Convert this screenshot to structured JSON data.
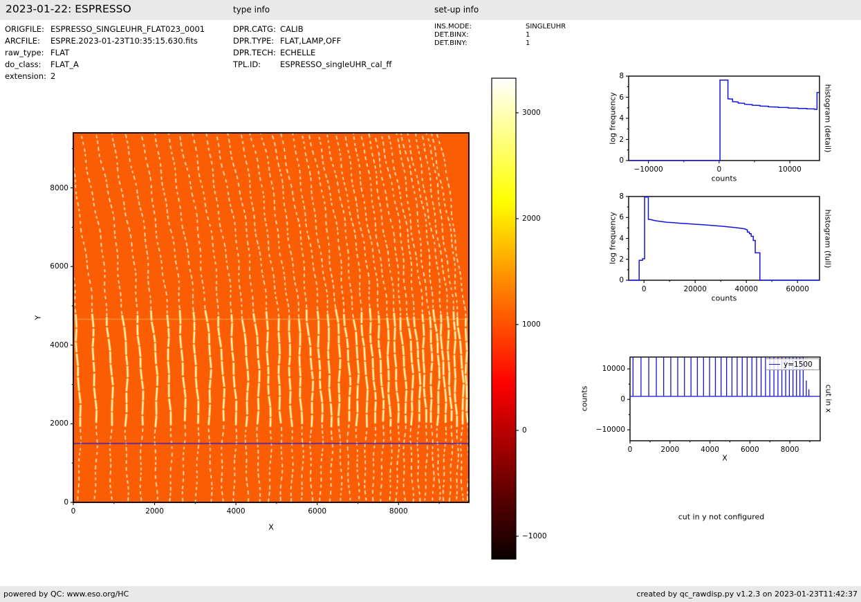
{
  "header": {
    "title": "2023-01-22: ESPRESSO",
    "type_info_title": "type info",
    "setup_info_title": "set-up info"
  },
  "metadata": {
    "file": [
      {
        "label": "ORIGFILE:",
        "value": "ESPRESSO_SINGLEUHR_FLAT023_0001"
      },
      {
        "label": "ARCFILE:",
        "value": "ESPRE.2023-01-23T10:35:15.630.fits"
      },
      {
        "label": "raw_type:",
        "value": "FLAT"
      },
      {
        "label": "do_class:",
        "value": "FLAT_A"
      },
      {
        "label": "extension:",
        "value": "2"
      }
    ],
    "type": [
      {
        "label": "DPR.CATG:",
        "value": "CALIB"
      },
      {
        "label": "DPR.TYPE:",
        "value": "FLAT,LAMP,OFF"
      },
      {
        "label": "DPR.TECH:",
        "value": "ECHELLE"
      },
      {
        "label": "TPL.ID:",
        "value": "ESPRESSO_singleUHR_cal_ff"
      }
    ],
    "setup": [
      {
        "label": "INS.MODE:",
        "value": "SINGLEUHR"
      },
      {
        "label": "DET.BINX:",
        "value": "1"
      },
      {
        "label": "DET.BINY:",
        "value": "1"
      }
    ]
  },
  "notes": {
    "cut_in_y": "cut in y not configured"
  },
  "footer": {
    "left": "powered by QC: www.eso.org/HC",
    "right": "created by qc_rawdisp.py v1.2.3 on 2023-01-23T11:42:37"
  },
  "colors": {
    "curve": "#1212e0",
    "image_background": "#fa5d04",
    "stripe_core": "#ffffff",
    "stripe_glow": "#ffc83c",
    "bar_bg": "#e9e9e9",
    "frame": "#000000"
  },
  "chart_data": [
    {
      "id": "raw-image",
      "type": "heatmap",
      "xlabel": "X",
      "ylabel": "Y",
      "xlim": [
        0,
        9730
      ],
      "ylim": [
        0,
        9400
      ],
      "xticks": [
        0,
        2000,
        4000,
        6000,
        8000
      ],
      "xminor": [
        1000,
        3000,
        5000,
        7000,
        9000
      ],
      "yticks": [
        0,
        2000,
        4000,
        6000,
        8000
      ],
      "yminor": [
        1000,
        3000,
        5000,
        7000,
        9000
      ],
      "description": "ESPRESSO echelle flat-field raw frame: ~40 curved dashed echelle order stripes on orange background (~1080 counts); orders brighter and nearly solid between y=1900 and y=4660; detector seam at y=4660; blue horizontal cut line at y=1500.",
      "background_counts": 1080,
      "cut_line_y": 1500,
      "bright_band_y": [
        1900,
        4660
      ],
      "seam_y": 4660,
      "order_positions": [
        150,
        550,
        939,
        1317,
        1684,
        2041,
        2388,
        2725,
        3052,
        3371,
        3680,
        3981,
        4274,
        4558,
        4834,
        5102,
        5363,
        5617,
        5863,
        6103,
        6336,
        6562,
        6782,
        6996,
        7203,
        7405,
        7601,
        7792,
        7977,
        8158,
        8333,
        8503,
        8668,
        8829,
        8985,
        9137,
        9285,
        9428,
        9568,
        9703
      ],
      "colorbar": {
        "colormap": "hot",
        "range": [
          -1216,
          3327
        ],
        "ticks": [
          -1000,
          0,
          1000,
          2000,
          3000
        ]
      }
    },
    {
      "id": "histogram-detail",
      "type": "line",
      "side_label": "histogram (detail)",
      "xlabel": "counts",
      "ylabel": "log frequency",
      "xlim": [
        -12800,
        14200
      ],
      "ylim": [
        0,
        8
      ],
      "xticks": [
        -10000,
        0,
        10000
      ],
      "xminor": [
        -5000,
        5000
      ],
      "yticks": [
        0,
        2,
        4,
        6,
        8
      ],
      "yminor": [
        1,
        3,
        5,
        7
      ],
      "points": [
        [
          -12800,
          0
        ],
        [
          120,
          0
        ],
        [
          120,
          7.62
        ],
        [
          1250,
          7.62
        ],
        [
          1250,
          5.85
        ],
        [
          1900,
          5.82
        ],
        [
          1900,
          5.58
        ],
        [
          2700,
          5.55
        ],
        [
          2700,
          5.45
        ],
        [
          3600,
          5.42
        ],
        [
          3600,
          5.33
        ],
        [
          4700,
          5.3
        ],
        [
          4700,
          5.24
        ],
        [
          5800,
          5.22
        ],
        [
          5800,
          5.16
        ],
        [
          7000,
          5.14
        ],
        [
          7000,
          5.09
        ],
        [
          8400,
          5.07
        ],
        [
          8400,
          5.03
        ],
        [
          9800,
          5.02
        ],
        [
          9800,
          4.98
        ],
        [
          11200,
          4.97
        ],
        [
          11200,
          4.94
        ],
        [
          12400,
          4.93
        ],
        [
          12400,
          4.9
        ],
        [
          13500,
          4.89
        ],
        [
          13500,
          4.85
        ],
        [
          13850,
          4.85
        ],
        [
          13850,
          6.45
        ],
        [
          14200,
          6.45
        ]
      ]
    },
    {
      "id": "histogram-full",
      "type": "line",
      "side_label": "histogram (full)",
      "xlabel": "counts",
      "ylabel": "log frequency",
      "xlim": [
        -6000,
        68600
      ],
      "ylim": [
        0,
        8
      ],
      "xticks": [
        0,
        20000,
        40000,
        60000
      ],
      "xminor": [
        10000,
        30000,
        50000
      ],
      "yticks": [
        0,
        2,
        4,
        6,
        8
      ],
      "yminor": [
        1,
        3,
        5,
        7
      ],
      "points": [
        [
          -6000,
          0
        ],
        [
          -1900,
          0
        ],
        [
          -1900,
          1.9
        ],
        [
          -600,
          1.9
        ],
        [
          -600,
          2.05
        ],
        [
          250,
          2.05
        ],
        [
          250,
          7.95
        ],
        [
          1700,
          7.95
        ],
        [
          1700,
          5.82
        ],
        [
          2600,
          5.8
        ],
        [
          3800,
          5.72
        ],
        [
          5200,
          5.66
        ],
        [
          7000,
          5.6
        ],
        [
          9000,
          5.54
        ],
        [
          11500,
          5.5
        ],
        [
          14000,
          5.45
        ],
        [
          17000,
          5.4
        ],
        [
          20000,
          5.35
        ],
        [
          23000,
          5.3
        ],
        [
          26000,
          5.25
        ],
        [
          28500,
          5.2
        ],
        [
          31000,
          5.15
        ],
        [
          33000,
          5.1
        ],
        [
          35000,
          5.05
        ],
        [
          36800,
          5.0
        ],
        [
          38300,
          4.95
        ],
        [
          39500,
          4.9
        ],
        [
          40400,
          4.8
        ],
        [
          40400,
          4.6
        ],
        [
          41200,
          4.6
        ],
        [
          41200,
          4.45
        ],
        [
          41900,
          4.45
        ],
        [
          41900,
          4.2
        ],
        [
          42700,
          4.2
        ],
        [
          42700,
          3.8
        ],
        [
          43500,
          3.8
        ],
        [
          43500,
          2.62
        ],
        [
          45300,
          2.62
        ],
        [
          45300,
          0
        ],
        [
          68600,
          0
        ]
      ]
    },
    {
      "id": "cut-in-x",
      "type": "spikes",
      "side_label": "cut in x",
      "xlabel": "X",
      "ylabel": "counts",
      "legend_label": "y=1500",
      "xlim": [
        0,
        9520
      ],
      "ylim": [
        -13600,
        13900
      ],
      "xticks": [
        0,
        2000,
        4000,
        6000,
        8000
      ],
      "xminor": [
        1000,
        3000,
        5000,
        7000,
        9000
      ],
      "yticks": [
        -10000,
        0,
        10000
      ],
      "yminor": [
        -5000,
        5000
      ],
      "baseline": 1000,
      "spikes": [
        [
          150,
          14500
        ],
        [
          550,
          14500
        ],
        [
          939,
          14500
        ],
        [
          1317,
          14500
        ],
        [
          1684,
          14500
        ],
        [
          2041,
          14500
        ],
        [
          2388,
          14500
        ],
        [
          2725,
          14500
        ],
        [
          3052,
          14500
        ],
        [
          3371,
          14500
        ],
        [
          3680,
          14500
        ],
        [
          3981,
          14500
        ],
        [
          4274,
          14500
        ],
        [
          4558,
          14500
        ],
        [
          4834,
          14500
        ],
        [
          5102,
          14500
        ],
        [
          5363,
          14500
        ],
        [
          5617,
          14500
        ],
        [
          5863,
          14500
        ],
        [
          6103,
          14500
        ],
        [
          6336,
          14500
        ],
        [
          6562,
          14500
        ],
        [
          6782,
          14500
        ],
        [
          6996,
          14500
        ],
        [
          7203,
          14500
        ],
        [
          7405,
          14500
        ],
        [
          7601,
          14500
        ],
        [
          7792,
          14500
        ],
        [
          7977,
          14500
        ],
        [
          8158,
          14500
        ],
        [
          8333,
          14500
        ],
        [
          8503,
          14500
        ],
        [
          8668,
          14500
        ],
        [
          8825,
          6200
        ],
        [
          8955,
          3300
        ]
      ]
    }
  ]
}
